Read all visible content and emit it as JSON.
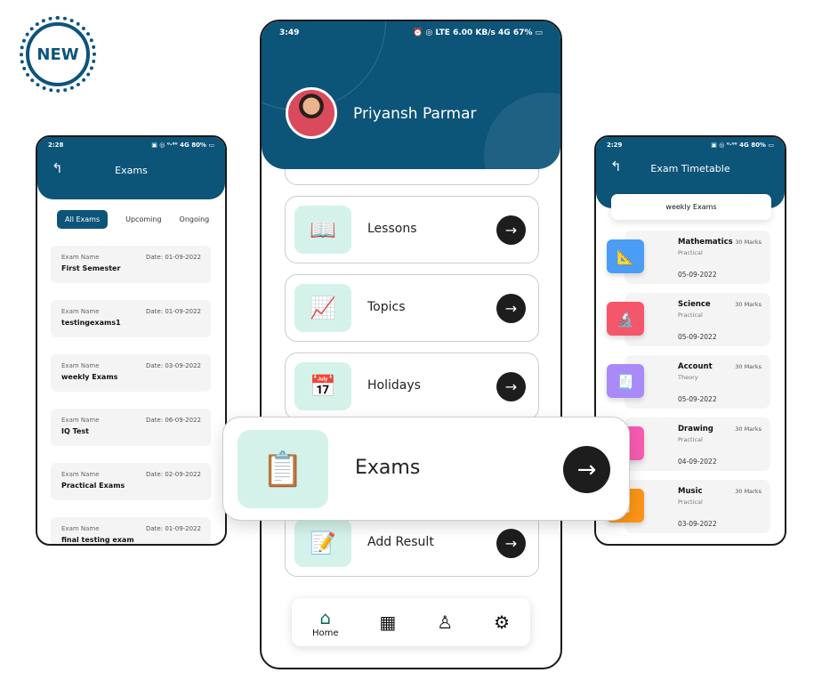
{
  "badge": {
    "label": "NEW"
  },
  "colors": {
    "primary": "#0d5479",
    "icon_bg": "#d4f2ea",
    "arrow": "#1d1d1d"
  },
  "left_phone": {
    "status": {
      "time": "2:28",
      "right": "▣ ◎ ⁰·⁶⁰ 4G 80% ▭"
    },
    "title": "Exams",
    "back_icon": "back-arrow-icon",
    "tabs": [
      {
        "label": "All Exams"
      },
      {
        "label": "Upcoming"
      },
      {
        "label": "Ongoing"
      }
    ],
    "exams": [
      {
        "label": "Exam Name",
        "date": "Date: 01-09-2022",
        "name": "First Semester"
      },
      {
        "label": "Exam Name",
        "date": "Date: 01-09-2022",
        "name": "testingexams1"
      },
      {
        "label": "Exam Name",
        "date": "Date: 03-09-2022",
        "name": "weekly Exams"
      },
      {
        "label": "Exam Name",
        "date": "Date: 06-09-2022",
        "name": "IQ Test"
      },
      {
        "label": "Exam Name",
        "date": "Date: 02-09-2022",
        "name": "Practical Exams"
      },
      {
        "label": "Exam Name",
        "date": "Date: 01-09-2022",
        "name": "final testing exam"
      }
    ]
  },
  "center_phone": {
    "status": {
      "time": "3:49",
      "right": "⏰ ◎ LTE 6.00 KB/s 4G 67% ▭"
    },
    "user_name": "Priyansh Parmar",
    "menu": [
      {
        "label": "Lessons",
        "icon": "lessons-icon"
      },
      {
        "label": "Topics",
        "icon": "topics-icon"
      },
      {
        "label": "Holidays",
        "icon": "holidays-icon"
      },
      {
        "label": "Add Result",
        "icon": "add-result-icon"
      }
    ],
    "highlight": {
      "label": "Exams",
      "icon": "exams-icon"
    },
    "nav": [
      {
        "label": "Home",
        "icon": "home-icon"
      },
      {
        "label": "",
        "icon": "calendar-icon"
      },
      {
        "label": "",
        "icon": "profile-icon"
      },
      {
        "label": "",
        "icon": "settings-icon"
      }
    ]
  },
  "right_phone": {
    "status": {
      "time": "2:29",
      "right": "▣ ◎ ⁰·⁰⁰ 4G 80% ▭"
    },
    "title": "Exam Timetable",
    "selected_exam": "weekly Exams",
    "subjects": [
      {
        "name": "Mathematics",
        "type": "Practical",
        "date": "05-09-2022",
        "marks": "30 Marks",
        "color": "#4a9cf5",
        "glyph": "📐"
      },
      {
        "name": "Science",
        "type": "Practical",
        "date": "05-09-2022",
        "marks": "30 Marks",
        "color": "#f4566a",
        "glyph": "🔬"
      },
      {
        "name": "Account",
        "type": "Theory",
        "date": "05-09-2022",
        "marks": "30 Marks",
        "color": "#a98af7",
        "glyph": "🧾"
      },
      {
        "name": "Drawing",
        "type": "Practical",
        "date": "04-09-2022",
        "marks": "30 Marks",
        "color": "#f65cb2",
        "glyph": "✎"
      },
      {
        "name": "Music",
        "type": "Practical",
        "date": "03-09-2022",
        "marks": "30 Marks",
        "color": "#fb9516",
        "glyph": "♫"
      }
    ]
  }
}
